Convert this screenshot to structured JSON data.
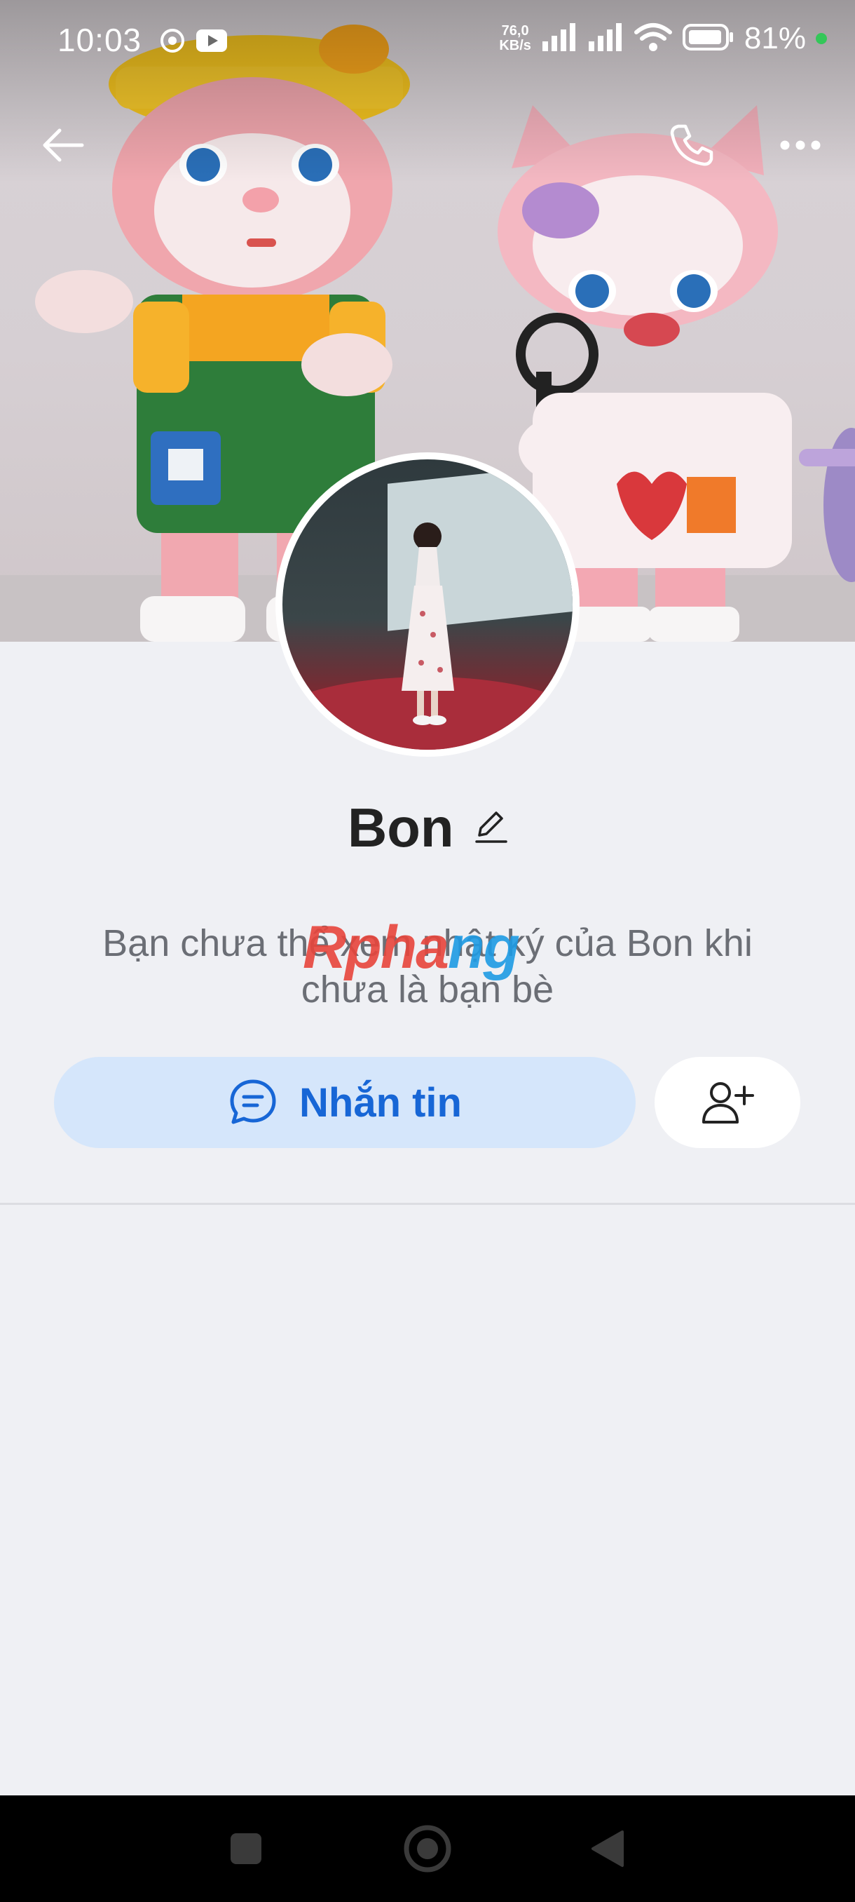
{
  "status_bar": {
    "time": "10:03",
    "net_speed_value": "76,0",
    "net_speed_unit": "KB/s",
    "battery": "81%",
    "icons": [
      "chrome-icon",
      "youtube-icon",
      "signal-icon",
      "signal-icon",
      "wifi-icon",
      "battery-icon"
    ]
  },
  "header": {
    "back_icon": "arrow-left-icon",
    "call_icon": "phone-icon",
    "more_icon": "more-horizontal-icon"
  },
  "profile": {
    "name": "Bon",
    "edit_icon": "pencil-icon",
    "notice": "Bạn chưa thể xem nhật ký của Bon khi chưa là bạn bè"
  },
  "watermark": {
    "part1": "Rpha",
    "part2": "ng"
  },
  "actions": {
    "message_label": "Nhắn tin",
    "message_icon": "chat-bubble-icon",
    "add_friend_icon": "add-user-icon"
  },
  "colors": {
    "accent": "#1766d6",
    "message_button_bg": "#d5e6fb",
    "page_bg": "#eff0f4"
  },
  "nav": {
    "icons": [
      "square-recent-icon",
      "circle-home-icon",
      "triangle-back-icon"
    ]
  }
}
